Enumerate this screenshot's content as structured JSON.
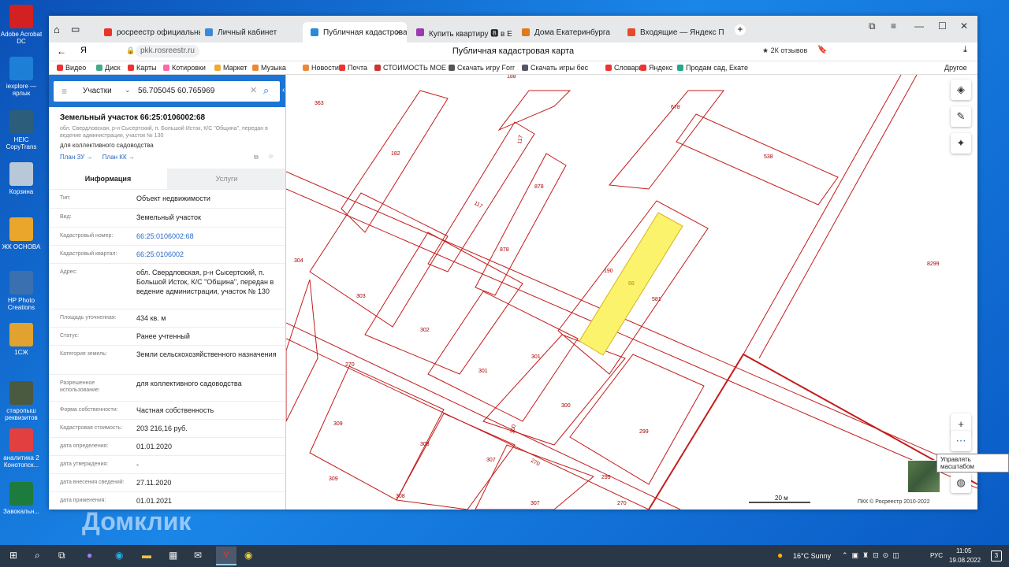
{
  "desktop": {
    "icons": [
      {
        "label": "Adobe Acrobat DC",
        "color": "#d32020"
      },
      {
        "label": "iexplore — ярлык",
        "color": "#1e7fd6"
      },
      {
        "label": "HEIC CopyTrans",
        "color": "#2c5d7a"
      },
      {
        "label": "Корзина",
        "color": "#b8c8d8"
      },
      {
        "label": "ЖК ОСНОВА",
        "color": "#e9a62a"
      },
      {
        "label": "HP Photo Creations",
        "color": "#3a6fb0"
      },
      {
        "label": "1СЖ",
        "color": "#e1a230"
      },
      {
        "label": "старопыш реквизитов",
        "color": "#4a5a40"
      },
      {
        "label": "аналитика 2 Конотопск...",
        "color": "#e24040"
      },
      {
        "label": "Завокальн...",
        "color": "#1e7b3e"
      }
    ],
    "watermark": "Домклик"
  },
  "browser": {
    "tabs": [
      {
        "label": "росреестр официальный",
        "color": "#e8352b"
      },
      {
        "label": "Личный кабинет",
        "color": "#3b8ad8"
      },
      {
        "label": "Публичная кадастрова",
        "color": "#2a8ad8",
        "active": true
      },
      {
        "label": "Купить квартиру 🅱 в Ека",
        "color": "#9c3bb0"
      },
      {
        "label": "Дома Екатеринбурга",
        "color": "#e0781c"
      },
      {
        "label": "Входящие — Яндекс Почт",
        "color": "#e54b2b"
      }
    ],
    "url": "pkk.rosreestr.ru",
    "page_title": "Публичная кадастровая карта",
    "reviews": "★ 2К отзывов",
    "bookmarks": [
      "Видео",
      "Диск",
      "Карты",
      "Котировки",
      "Маркет",
      "Музыка",
      "Новости",
      "Почта",
      "СТОИМОСТЬ МОЕ",
      "Скачать игру Forr",
      "Скачать игры бес",
      "Словари",
      "Яндекс",
      "Продам сад, Екате"
    ],
    "other": "Другое"
  },
  "panel": {
    "search_type": "Участки",
    "search_value": "56.705045 60.765969",
    "title": "Земельный участок 66:25:0106002:68",
    "subtitle": "обл. Свердловская, р-н Сысертский, п. Большой Исток, К/С \"Община\", передан в ведение администрации, участок № 130",
    "purpose": "для коллективного садоводства",
    "link1": "План ЗУ →",
    "link2": "План КК →",
    "tab_info": "Информация",
    "tab_services": "Услуги",
    "props": [
      {
        "k": "Тип:",
        "v": "Объект недвижимости"
      },
      {
        "k": "Вид:",
        "v": "Земельный участок"
      },
      {
        "k": "Кадастровый номер:",
        "v": "66:25:0106002:68",
        "link": true
      },
      {
        "k": "Кадастровый квартал:",
        "v": "66:25:0106002",
        "link": true
      },
      {
        "k": "Адрес:",
        "v": "обл. Свердловская, р-н Сысертский, п. Большой Исток, К/С \"Община\", передан в ведение администрации, участок № 130"
      },
      {
        "k": "Площадь уточненная:",
        "v": "434 кв. м"
      },
      {
        "k": "Статус:",
        "v": "Ранее учтенный"
      },
      {
        "k": "Категория земель:",
        "v": "Земли сельскохозяйственного назначения"
      },
      {
        "k": "Разрешенное использование:",
        "v": "для коллективного садоводства"
      },
      {
        "k": "Форма собственности:",
        "v": "Частная собственность"
      },
      {
        "k": "Кадастровая стоимость:",
        "v": "203 216,16 руб."
      },
      {
        "k": "дата определения:",
        "v": "01.01.2020"
      },
      {
        "k": "дата утверждения:",
        "v": "-"
      },
      {
        "k": "дата внесения сведений:",
        "v": "27.11.2020"
      },
      {
        "k": "дата применения:",
        "v": "01.01.2021"
      }
    ]
  },
  "map": {
    "labels": [
      "188",
      "363",
      "182",
      "117",
      "117",
      "678",
      "538",
      "878",
      "878",
      "190",
      "68",
      "581",
      "304",
      "303",
      "302",
      "301",
      "301",
      "8299",
      "270",
      "300",
      "299",
      "309",
      "308",
      "307",
      "270",
      "300",
      "309",
      "308",
      "307",
      "299",
      "270"
    ],
    "scale": "20 м",
    "copyright": "ПКК © Росреестр 2010-2022",
    "tooltip": "Управлять масштабом"
  },
  "taskbar": {
    "weather": "16°C  Sunny",
    "lang": "РУС",
    "time": "11:05",
    "date": "19.08.2022",
    "notif": "3"
  }
}
